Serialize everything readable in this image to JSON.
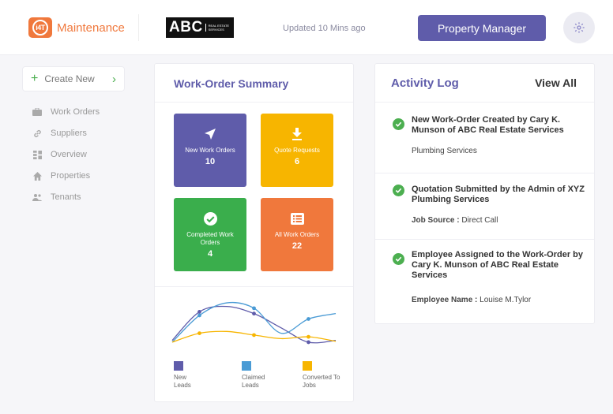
{
  "header": {
    "logo_mark": "i4T",
    "app_name": "Maintenance",
    "abc_main": "ABC",
    "abc_sub": "Real Estate Services",
    "updated": "Updated 10 Mins ago",
    "role_button": "Property Manager"
  },
  "sidebar": {
    "create_new": "Create New",
    "items": [
      {
        "label": "Work Orders",
        "icon": "briefcase-icon"
      },
      {
        "label": "Suppliers",
        "icon": "link-icon"
      },
      {
        "label": "Overview",
        "icon": "grid-icon"
      },
      {
        "label": "Properties",
        "icon": "home-icon"
      },
      {
        "label": "Tenants",
        "icon": "users-icon"
      }
    ]
  },
  "summary": {
    "title": "Work-Order Summary",
    "tiles": [
      {
        "label": "New Work Orders",
        "count": "10",
        "color": "#5f5caa",
        "icon": "send-icon"
      },
      {
        "label": "Quote Requests",
        "count": "6",
        "color": "#f7b500",
        "icon": "download-icon"
      },
      {
        "label": "Completed Work Orders",
        "count": "4",
        "color": "#3aae4c",
        "icon": "check-circle-icon"
      },
      {
        "label": "All Work Orders",
        "count": "22",
        "color": "#f0783c",
        "icon": "list-icon"
      }
    ],
    "legend": [
      {
        "label": "New Leads",
        "color": "#5f5caa"
      },
      {
        "label": "Claimed Leads",
        "color": "#4a9bd5"
      },
      {
        "label": "Converted To Jobs",
        "color": "#f7b500"
      }
    ]
  },
  "activity": {
    "title": "Activity Log",
    "view_all": "View All",
    "items": [
      {
        "head": "New Work-Order Created by Cary K. Munson of ABC Real Estate Services",
        "sub_label": "",
        "sub_value": "Plumbing Services"
      },
      {
        "head": "Quotation Submitted by the Admin of XYZ Plumbing Services",
        "sub_label": "Job Source :",
        "sub_value": "Direct Call"
      },
      {
        "head": "Employee Assigned to the Work-Order by Cary K. Munson of ABC Real Estate Services",
        "sub_label": "Employee Name :",
        "sub_value": "Louise M.Tylor"
      }
    ]
  },
  "chart_data": {
    "type": "line",
    "title": "",
    "xlabel": "",
    "ylabel": "",
    "x": [
      0,
      1,
      2,
      3,
      4,
      5,
      6
    ],
    "series": [
      {
        "name": "New Leads",
        "color": "#5f5caa",
        "values": [
          10,
          42,
          48,
          40,
          24,
          8,
          10
        ]
      },
      {
        "name": "Claimed Leads",
        "color": "#4a9bd5",
        "values": [
          8,
          38,
          52,
          46,
          18,
          34,
          40
        ]
      },
      {
        "name": "Converted To Jobs",
        "color": "#f7b500",
        "values": [
          8,
          18,
          20,
          16,
          12,
          14,
          9
        ]
      }
    ],
    "ylim": [
      0,
      60
    ],
    "grid": false,
    "legend": "bottom"
  }
}
